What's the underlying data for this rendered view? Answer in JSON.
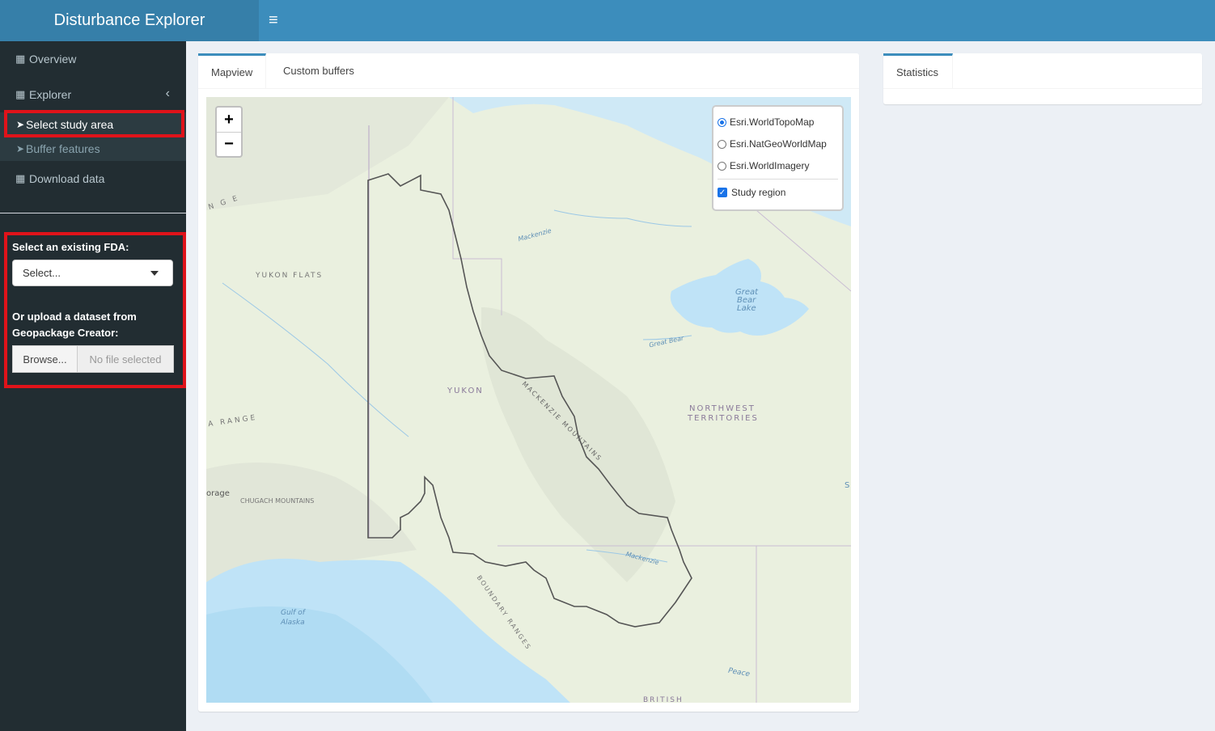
{
  "app": {
    "title": "Disturbance Explorer",
    "toggle_icon": "hamburger-icon"
  },
  "sidebar": {
    "menu": [
      {
        "label": "Overview",
        "icon": "table-icon"
      },
      {
        "label": "Explorer",
        "icon": "table-icon",
        "chevron": "chevron-left-icon"
      },
      {
        "label": "Download data",
        "icon": "table-icon"
      }
    ],
    "submenu": [
      {
        "label": "Select study area",
        "icon": "pointer-icon",
        "active": true
      },
      {
        "label": "Buffer features",
        "icon": "pointer-icon",
        "active": false
      }
    ],
    "form": {
      "select_label": "Select an existing FDA:",
      "select_value": "Select...",
      "upload_label_line1": "Or upload a dataset from",
      "upload_label_line2": "Geopackage Creator:",
      "browse_label": "Browse...",
      "file_placeholder": "No file selected"
    }
  },
  "main": {
    "tabs": [
      {
        "label": "Mapview",
        "active": true
      },
      {
        "label": "Custom buffers",
        "active": false
      }
    ]
  },
  "map": {
    "zoom_in": "+",
    "zoom_out": "−",
    "layers": {
      "basemaps": [
        {
          "label": "Esri.WorldTopoMap",
          "selected": true
        },
        {
          "label": "Esri.NatGeoWorldMap",
          "selected": false
        },
        {
          "label": "Esri.WorldImagery",
          "selected": false
        }
      ],
      "overlays": [
        {
          "label": "Study region",
          "checked": true
        }
      ]
    },
    "labels": {
      "yukon_flats": "YUKON FLATS",
      "yukon": "YUKON",
      "mackenzie_mountains": "MACKENZIE MOUNTAINS",
      "nwt_line1": "NORTHWEST",
      "nwt_line2": "TERRITORIES",
      "great_bear_line1": "Great",
      "great_bear_line2": "Bear",
      "great_bear_line3": "Lake",
      "great_bear_river": "Great Bear",
      "mackenzie_north": "Mackenzie",
      "mackenzie_south": "Mackenzie",
      "chugach": "CHUGACH MOUNTAINS",
      "gulf_line1": "Gulf of",
      "gulf_line2": "Alaska",
      "boundary_ranges": "BOUNDARY RANGES",
      "range_west": "A  RANGE",
      "range_nw": "N G E",
      "anchorage_partial": "orage",
      "peace": "Peace",
      "british": "BRITISH",
      "s_edge": "S"
    },
    "colors": {
      "land": "#eaf0df",
      "water": "#bfe3f7",
      "study_outline": "#555555"
    }
  },
  "stats": {
    "tab_label": "Statistics"
  },
  "colors": {
    "header_logo": "#367fa9",
    "header_bar": "#3c8dbc",
    "sidebar_bg": "#222d32",
    "highlight": "#e0131a"
  }
}
